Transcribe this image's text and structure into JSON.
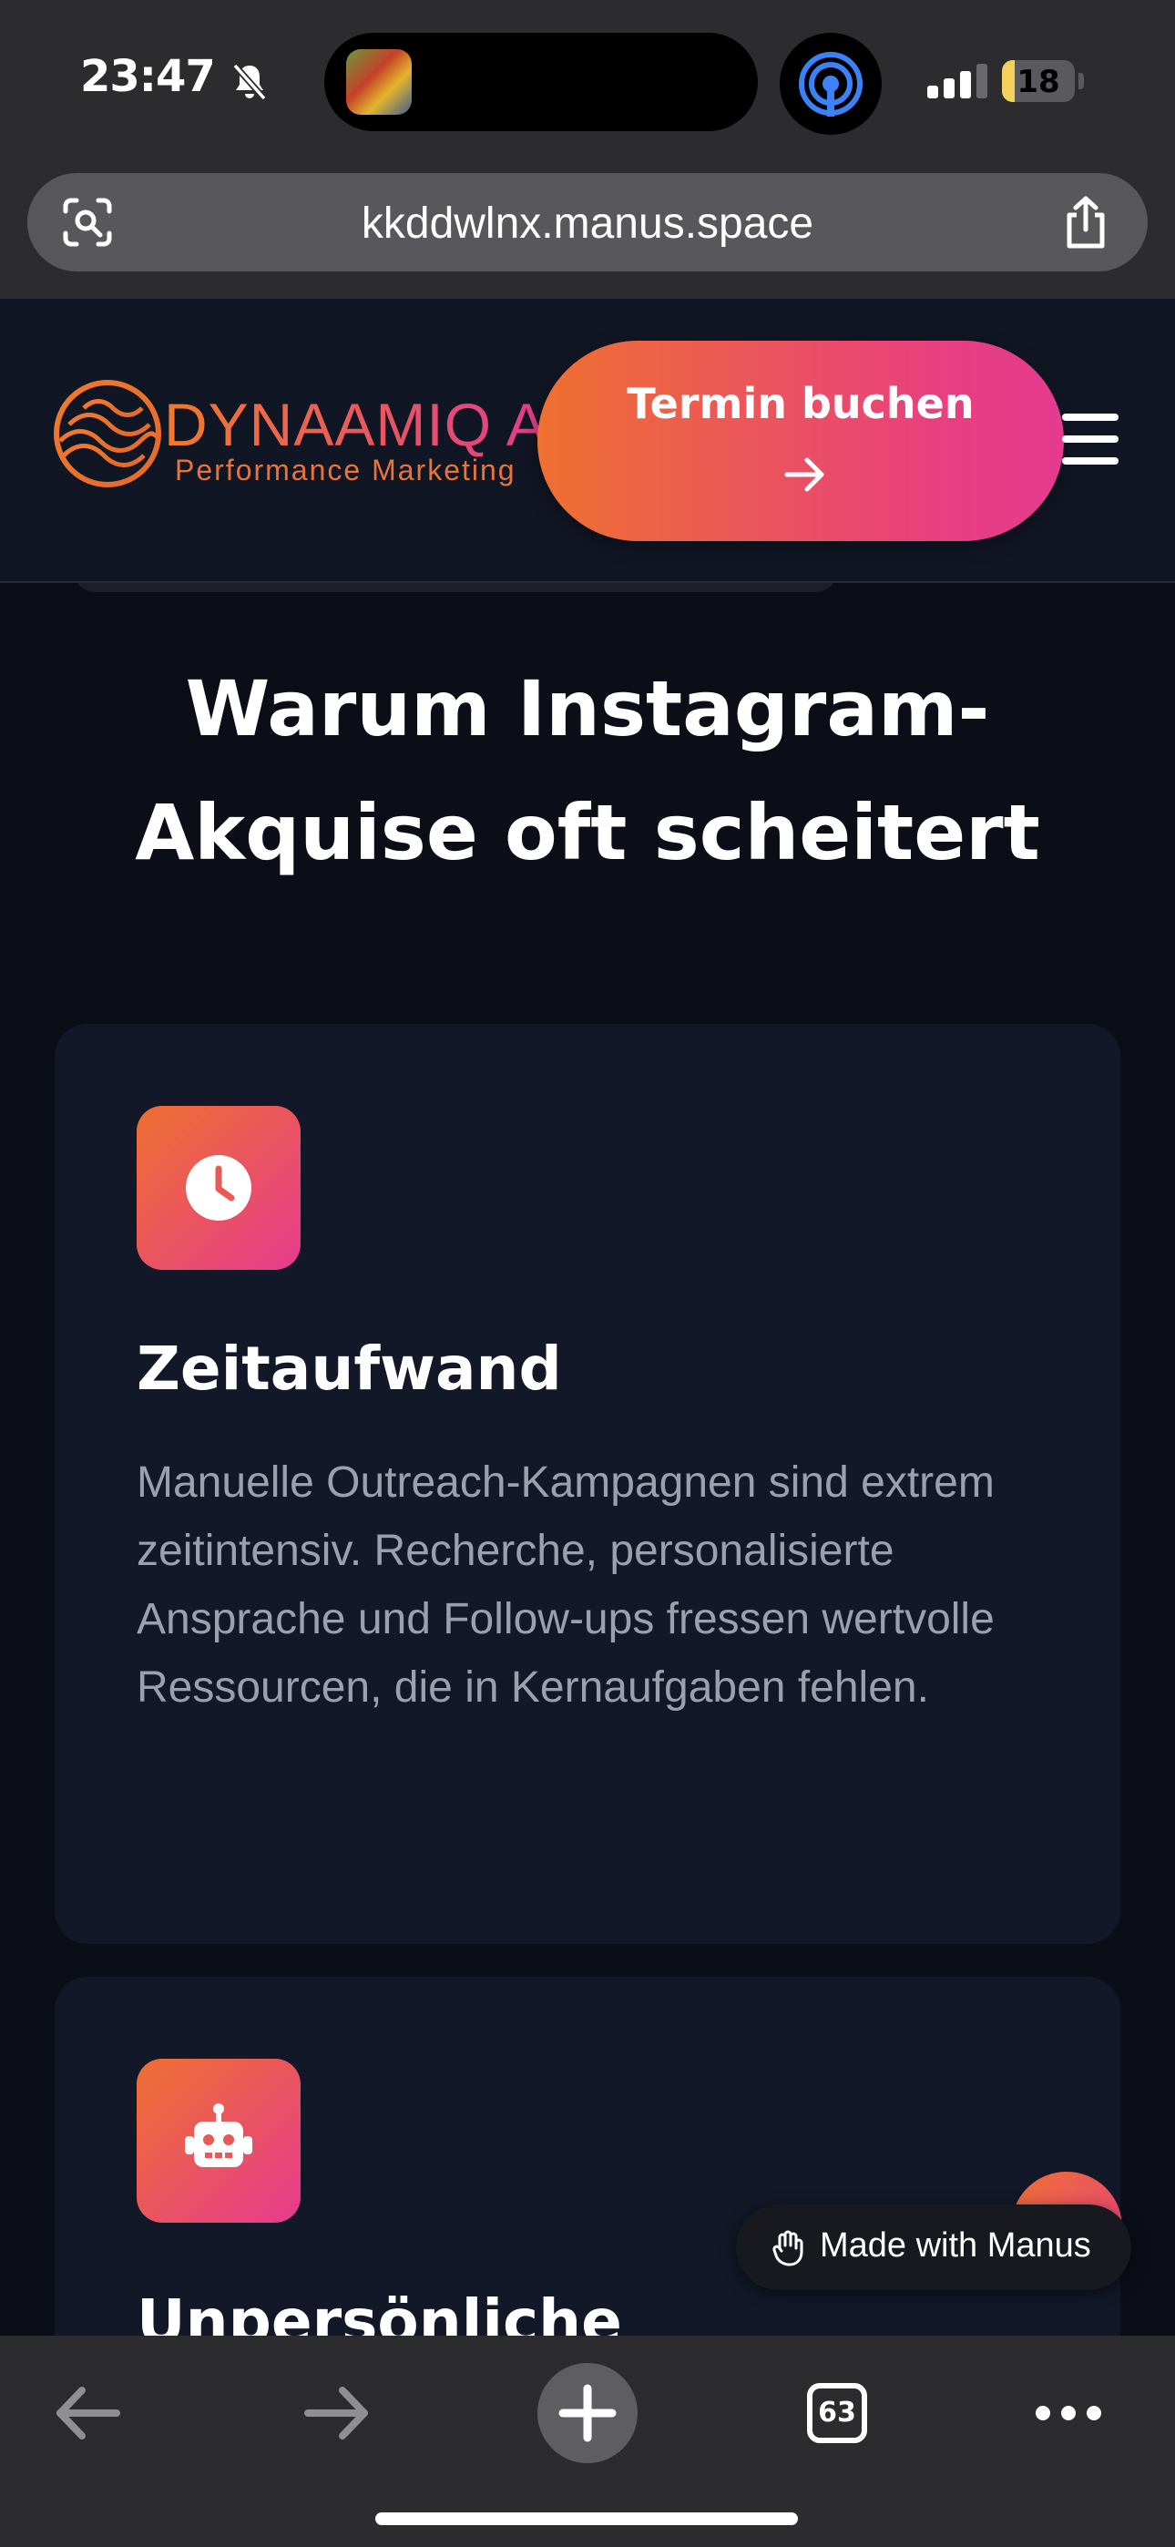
{
  "status_bar": {
    "time": "23:47",
    "battery_level": "18",
    "battery_fraction": 0.18
  },
  "browser": {
    "url": "kkddwlnx.manus.space",
    "tabs_count": "63"
  },
  "header": {
    "logo_name": "DYNAAMIQ AI",
    "logo_tagline": "Performance Marketing",
    "cta_label": "Termin buchen",
    "accent_start": "#ef7030",
    "accent_end": "#e63b8e"
  },
  "section": {
    "title": "Warum Instagram-Akquise oft scheitert",
    "cards": [
      {
        "icon": "clock-icon",
        "title": "Zeitaufwand",
        "text": "Manuelle Outreach-Kampagnen sind extrem zeitintensiv. Recherche, personalisierte Ansprache und Follow-ups fressen wertvolle Ressourcen, die in Kernaufgaben fehlen."
      },
      {
        "icon": "robot-icon",
        "title": "Unpersönliche"
      }
    ]
  },
  "badge": {
    "label": "Made with Manus"
  },
  "icons": {
    "lens": "lens-icon",
    "share": "share-icon",
    "back": "back-arrow-icon",
    "forward": "forward-arrow-icon",
    "new_tab": "plus-icon",
    "more": "ellipsis-icon",
    "menu": "hamburger-icon"
  }
}
